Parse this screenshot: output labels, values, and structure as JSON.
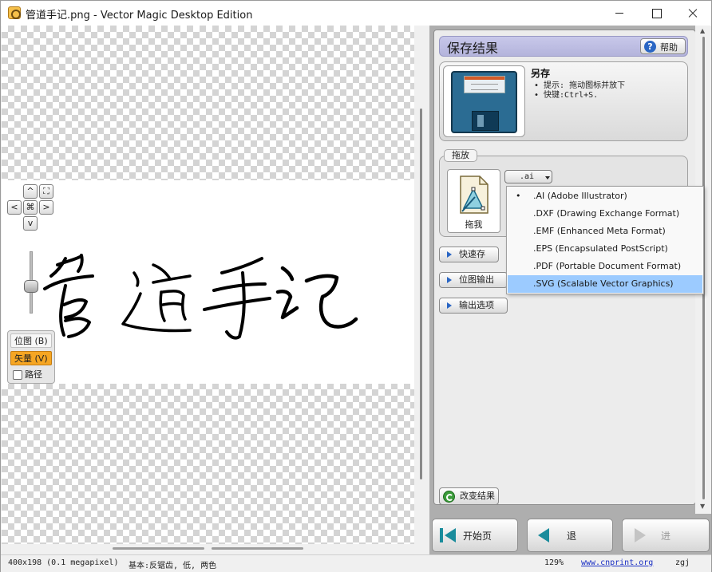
{
  "window": {
    "title": "管道手记.png - Vector Magic Desktop Edition"
  },
  "canvas": {
    "nav_buttons": [
      "^",
      "<",
      "⌘",
      ">",
      "v"
    ],
    "view_panel": {
      "bitmap_label": "位图 (B)",
      "vector_label": "矢量 (V)",
      "path_label": "路径"
    }
  },
  "panel": {
    "section_title": "保存结果",
    "help_label": "帮助",
    "save": {
      "title": "另存",
      "hint1": "• 提示: 拖动图标并放下",
      "hint2": "• 快键:Ctrl+S."
    },
    "drag": {
      "legend": "拖放",
      "caption": "拖我",
      "selected_format": ".ai"
    },
    "buttons": {
      "quick_save": "快速存",
      "bitmap_output": "位图输出",
      "output_options": "输出选项",
      "change_result": "改变结果"
    },
    "nav": {
      "start": "开始页",
      "back": "退",
      "next": "进"
    }
  },
  "format_dropdown": {
    "options": [
      {
        "label": ".AI (Adobe Illustrator)",
        "selected": true
      },
      {
        "label": ".DXF (Drawing Exchange Format)",
        "selected": false
      },
      {
        "label": ".EMF (Enhanced Meta Format)",
        "selected": false
      },
      {
        "label": ".EPS (Encapsulated PostScript)",
        "selected": false
      },
      {
        "label": ".PDF (Portable Document Format)",
        "selected": false
      },
      {
        "label": ".SVG (Scalable Vector Graphics)",
        "selected": false,
        "highlighted": true
      }
    ]
  },
  "statusbar": {
    "size": "400x198 (0.1 megapixel)",
    "basic": "基本:反锯齿, 低, 两色",
    "zoom": "129%",
    "link": "www.cnprint.org",
    "user": "zgj"
  },
  "colors": {
    "vector_active": "#f6a623",
    "header_bg": "#c8c8ea",
    "highlight": "#9ccbff",
    "link": "#1a2fc4"
  }
}
